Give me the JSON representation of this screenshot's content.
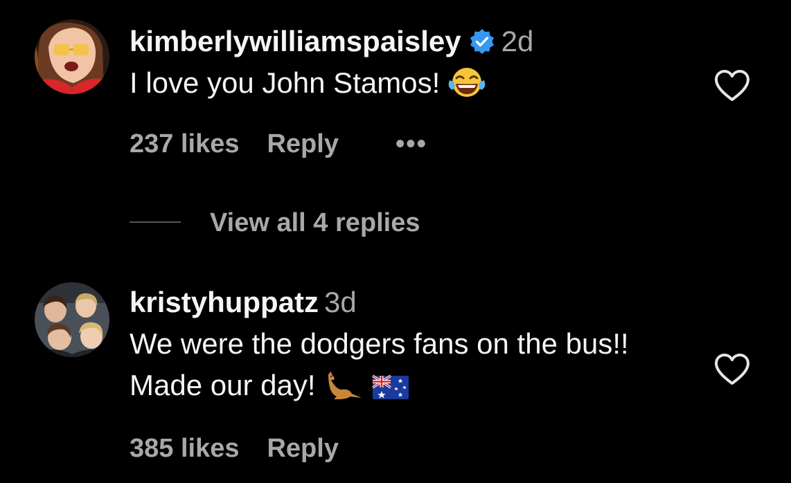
{
  "comments": [
    {
      "username": "kimberlywilliamspaisley",
      "verified": true,
      "time": "2d",
      "text": "I love you John Stamos!",
      "emoji": [
        "face-with-tears-of-joy"
      ],
      "likes": "237 likes",
      "reply_label": "Reply",
      "more_label": "•••",
      "view_replies": "View all 4 replies"
    },
    {
      "username": "kristyhuppatz",
      "verified": false,
      "time": "3d",
      "text": "We were the dodgers fans on the bus!! Made our day!",
      "emoji": [
        "kangaroo",
        "flag-australia"
      ],
      "likes": "385 likes",
      "reply_label": "Reply"
    }
  ],
  "colors": {
    "background": "#000000",
    "primary_text": "#f5f5f5",
    "secondary_text": "#a8a8a8",
    "verified_badge": "#3897f0"
  }
}
